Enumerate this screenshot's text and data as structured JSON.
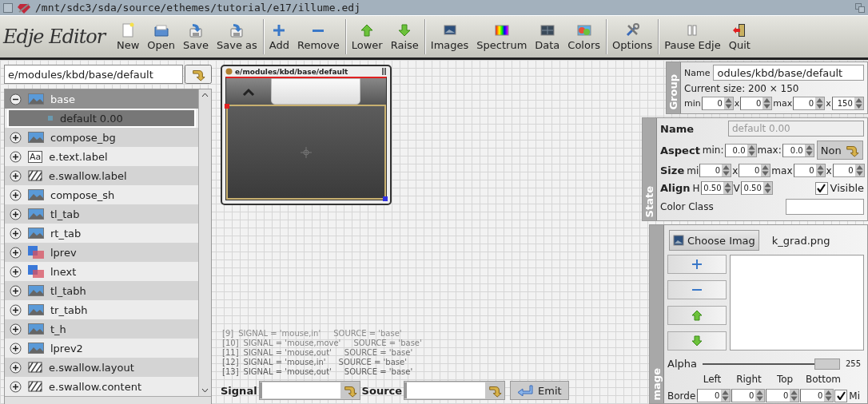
{
  "window": {
    "title": "/mnt/sdc3/sda/source/ethemes/tutorial/e17/illume.edj"
  },
  "toolbar": {
    "logo": "Edje Editor",
    "groups": [
      [
        {
          "label": "New",
          "kind": "new"
        },
        {
          "label": "Open",
          "kind": "open"
        },
        {
          "label": "Save",
          "kind": "save"
        },
        {
          "label": "Save as",
          "kind": "saveas"
        }
      ],
      [
        {
          "label": "Add",
          "kind": "add"
        },
        {
          "label": "Remove",
          "kind": "remove"
        }
      ],
      [
        {
          "label": "Lower",
          "kind": "lower"
        },
        {
          "label": "Raise",
          "kind": "raise"
        }
      ],
      [
        {
          "label": "Images",
          "kind": "images"
        },
        {
          "label": "Spectrum",
          "kind": "spectrum"
        },
        {
          "label": "Data",
          "kind": "data"
        },
        {
          "label": "Colors",
          "kind": "colors"
        }
      ],
      [
        {
          "label": "Options",
          "kind": "options"
        }
      ],
      [
        {
          "label": "Pause Edje",
          "kind": "pause"
        },
        {
          "label": "Quit",
          "kind": "quit"
        }
      ]
    ]
  },
  "parts_panel": {
    "path": "e/modules/kbd/base/default",
    "tree": [
      {
        "label": "base",
        "kind": "image",
        "expanded": true,
        "selected": false,
        "children": [
          {
            "label": "default 0.00",
            "kind": "state",
            "selected": true
          }
        ]
      },
      {
        "label": "compose_bg",
        "kind": "image",
        "expanded": false,
        "selected": false
      },
      {
        "label": "e.text.label",
        "kind": "text",
        "icon_text": "Aa",
        "expanded": false,
        "selected": false
      },
      {
        "label": "e.swallow.label",
        "kind": "swallow",
        "expanded": false,
        "selected": false
      },
      {
        "label": "compose_sh",
        "kind": "image",
        "expanded": false,
        "selected": false
      },
      {
        "label": "tl_tab",
        "kind": "image",
        "expanded": false,
        "selected": false
      },
      {
        "label": "rt_tab",
        "kind": "image",
        "expanded": false,
        "selected": false
      },
      {
        "label": "lprev",
        "kind": "rect",
        "expanded": false,
        "selected": false
      },
      {
        "label": "lnext",
        "kind": "rect",
        "expanded": false,
        "selected": false
      },
      {
        "label": "tl_tabh",
        "kind": "image",
        "expanded": false,
        "selected": false
      },
      {
        "label": "tr_tabh",
        "kind": "image",
        "expanded": false,
        "selected": false
      },
      {
        "label": "t_h",
        "kind": "image",
        "expanded": false,
        "selected": false
      },
      {
        "label": "lprev2",
        "kind": "image",
        "expanded": false,
        "selected": false
      },
      {
        "label": "e.swallow.layout",
        "kind": "swallow",
        "expanded": false,
        "selected": false
      },
      {
        "label": "e.swallow.content",
        "kind": "swallow",
        "expanded": false,
        "selected": false
      }
    ]
  },
  "preview": {
    "title": "e/modules/kbd/base/default"
  },
  "log": [
    {
      "index": "[9]",
      "signal": "SIGNAL = 'mouse,in'",
      "source": "SOURCE = 'base'"
    },
    {
      "index": "[10]",
      "signal": "SIGNAL = 'mouse,move'",
      "source": "SOURCE = 'base'"
    },
    {
      "index": "[11]",
      "signal": "SIGNAL = 'mouse,out'",
      "source": "SOURCE = 'base'"
    },
    {
      "index": "[12]",
      "signal": "SIGNAL = 'mouse,in'",
      "source": "SOURCE = 'base'"
    },
    {
      "index": "[13]",
      "signal": "SIGNAL = 'mouse,out'",
      "source": "SOURCE = 'base'"
    }
  ],
  "signal_bar": {
    "signal_label": "Signal",
    "source_label": "Source",
    "emit": "Emit"
  },
  "group_panel": {
    "tab": "Group",
    "name_label": "Name",
    "name_value": "odules/kbd/base/default",
    "size_text": "Current size: 200 × 150",
    "limits": [
      {
        "kind": "label",
        "text": "min"
      },
      {
        "kind": "spin",
        "value": "0"
      },
      {
        "kind": "label",
        "text": "x"
      },
      {
        "kind": "spin",
        "value": "0"
      },
      {
        "kind": "label",
        "text": "max"
      },
      {
        "kind": "spin",
        "value": "0"
      },
      {
        "kind": "label",
        "text": "x"
      },
      {
        "kind": "spin",
        "value": "150"
      }
    ]
  },
  "state_panel": {
    "tab": "State",
    "rows": [
      {
        "items": [
          {
            "kind": "heading",
            "text": "Name"
          },
          {
            "kind": "field",
            "value": "default 0.00",
            "disabled": true
          }
        ]
      },
      {
        "items": [
          {
            "kind": "heading",
            "text": "Aspect"
          },
          {
            "kind": "label",
            "text": "min:"
          },
          {
            "kind": "spin",
            "value": "0.0"
          },
          {
            "kind": "label",
            "text": "max:"
          },
          {
            "kind": "spin",
            "value": "0.0"
          },
          {
            "kind": "button",
            "text": "Non"
          }
        ]
      },
      {
        "items": [
          {
            "kind": "heading",
            "text": "Size"
          },
          {
            "kind": "label",
            "text": "mi"
          },
          {
            "kind": "spin",
            "value": "0"
          },
          {
            "kind": "label",
            "text": "x"
          },
          {
            "kind": "spin",
            "value": "0"
          },
          {
            "kind": "label",
            "text": "max"
          },
          {
            "kind": "spin",
            "value": "0"
          },
          {
            "kind": "label",
            "text": "x"
          },
          {
            "kind": "spin",
            "value": "0"
          }
        ]
      },
      {
        "items": [
          {
            "kind": "heading",
            "text": "Align"
          },
          {
            "kind": "label",
            "text": "H"
          },
          {
            "kind": "spin",
            "value": "0.50"
          },
          {
            "kind": "label",
            "text": "V"
          },
          {
            "kind": "spin",
            "value": "0.50"
          },
          {
            "kind": "checkbox",
            "text": "Visible",
            "checked": true
          }
        ]
      },
      {
        "items": [
          {
            "kind": "label",
            "text": "Color Class"
          },
          {
            "kind": "field",
            "disabled": false
          }
        ]
      }
    ]
  },
  "image_panel": {
    "tab": "mage",
    "choose_button": "Choose Imag",
    "image_name": "k_grad.png",
    "tools": [
      {
        "kind": "add"
      },
      {
        "kind": "remove"
      },
      {
        "kind": "up"
      },
      {
        "kind": "down"
      }
    ],
    "alpha": {
      "label": "Alpha",
      "level": 1,
      "reading": "255"
    },
    "border": {
      "headers": [
        "Left",
        "Right",
        "Top",
        "Bottom"
      ],
      "label": "Borde",
      "values": [
        "0",
        "0",
        "0",
        "0"
      ],
      "middle": {
        "label": "Mi",
        "checked": true
      }
    }
  }
}
